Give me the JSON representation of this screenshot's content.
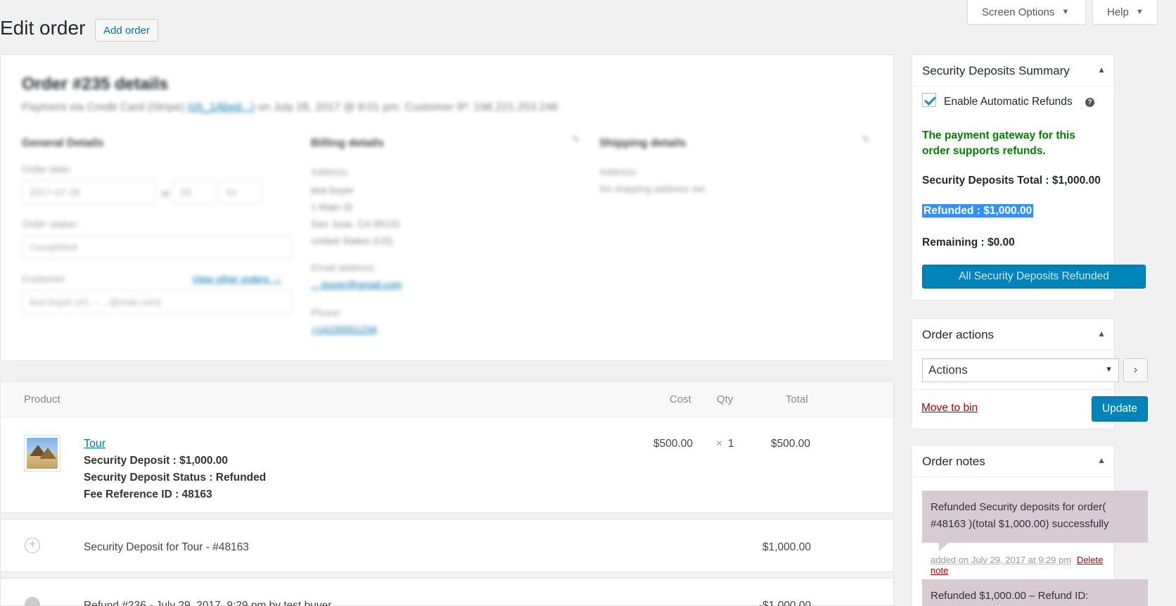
{
  "header": {
    "screen_options": "Screen Options",
    "help": "Help",
    "page_title": "Edit order",
    "add_order": "Add order"
  },
  "order": {
    "heading": "Order #235 details",
    "sub_prefix": "Payment via Credit Card (Stripe)",
    "sub_link": "(ch_1Abxd...)",
    "sub_suffix": "on July 28, 2017 @ 8:01 pm. Customer IP: 198.221.253.246",
    "general_heading": "General Details",
    "billing_heading": "Billing details",
    "shipping_heading": "Shipping details",
    "order_date_label": "Order date:",
    "order_date": "2017-07-28",
    "at": "at",
    "hour": "20",
    "minute": "01",
    "status_label": "Order status:",
    "status": "Completed",
    "customer_label": "Customer:",
    "view_other_orders": "View other orders →",
    "customer": "test buyer (#1 – ...@mail.com)",
    "address_label": "Address:",
    "billing_address": [
      "test buyer",
      "1 Main St",
      "San Jose, CA 95131",
      "United States (US)"
    ],
    "email_label": "Email address:",
    "email": "...-buyer@gmail.com",
    "phone_label": "Phone:",
    "phone": "+14155551234",
    "shipping_address_label": "Address:",
    "shipping_address": "No shipping address set."
  },
  "items": {
    "col_product": "Product",
    "col_cost": "Cost",
    "col_qty": "Qty",
    "col_total": "Total",
    "line": {
      "name": "Tour",
      "meta": [
        "Security Deposit : $1,000.00",
        "Security Deposit Status : Refunded",
        "Fee Reference ID : 48163"
      ],
      "cost": "$500.00",
      "qty_x": "×",
      "qty": "1",
      "total": "$500.00"
    },
    "fee": {
      "label": "Security Deposit for Tour - #48163",
      "total": "$1,000.00"
    },
    "refund": {
      "label": "Refund #236 - July 29, 2017, 9:29 pm by test buyer",
      "total": "-$1,000.00"
    }
  },
  "deposits": {
    "title": "Security Deposits Summary",
    "enable_label": "Enable Automatic Refunds",
    "gateway_msg": "The payment gateway for this order supports refunds.",
    "total": "Security Deposits Total : $1,000.00",
    "refunded": "Refunded : $1,000.00",
    "remaining": "Remaining : $0.00",
    "button": "All Security Deposits Refunded"
  },
  "order_actions": {
    "title": "Order actions",
    "select_value": "Actions",
    "go": "›",
    "move_to_bin": "Move to bin",
    "update": "Update"
  },
  "order_notes": {
    "title": "Order notes",
    "notes": [
      {
        "text": "Refunded Security deposits for order( #48163 )(total $1,000.00) successfully",
        "meta_date": "added on July 29, 2017 at 9:29 pm",
        "delete": "Delete note"
      },
      {
        "text": "Refunded $1,000.00 – Refund ID:"
      }
    ]
  },
  "colors": {
    "accent": "#0085ba",
    "link": "#0073aa",
    "success": "#008000",
    "danger": "#a00000",
    "note_bg": "#d7cad2"
  }
}
